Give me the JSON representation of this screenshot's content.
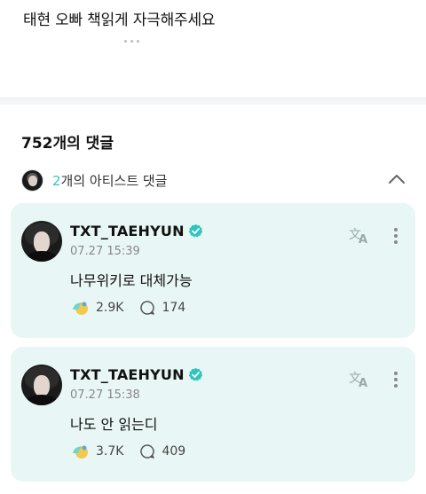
{
  "post": {
    "text": "태현 오빠 책읽게 자극해주세요"
  },
  "comments_section": {
    "count_title": "752개의 댓글",
    "artist_filter": {
      "count": "2",
      "label": "개의 아티스트 댓글"
    }
  },
  "comments": [
    {
      "author": "TXT_TAEHYUN",
      "time": "07.27 15:39",
      "text": "나무위키로 대체가능",
      "likes": "2.9K",
      "replies": "174"
    },
    {
      "author": "TXT_TAEHYUN",
      "time": "07.27 15:38",
      "text": "나도 안 읽는디",
      "likes": "3.7K",
      "replies": "409"
    }
  ],
  "colors": {
    "accent": "#31c6c4",
    "card_bg": "#e8f7f5",
    "verified": "#2fc4bd"
  },
  "icons": [
    "chevron-up-icon",
    "verified-badge-icon",
    "translate-icon",
    "more-vertical-icon",
    "like-reaction-icon",
    "reply-bubble-icon"
  ]
}
